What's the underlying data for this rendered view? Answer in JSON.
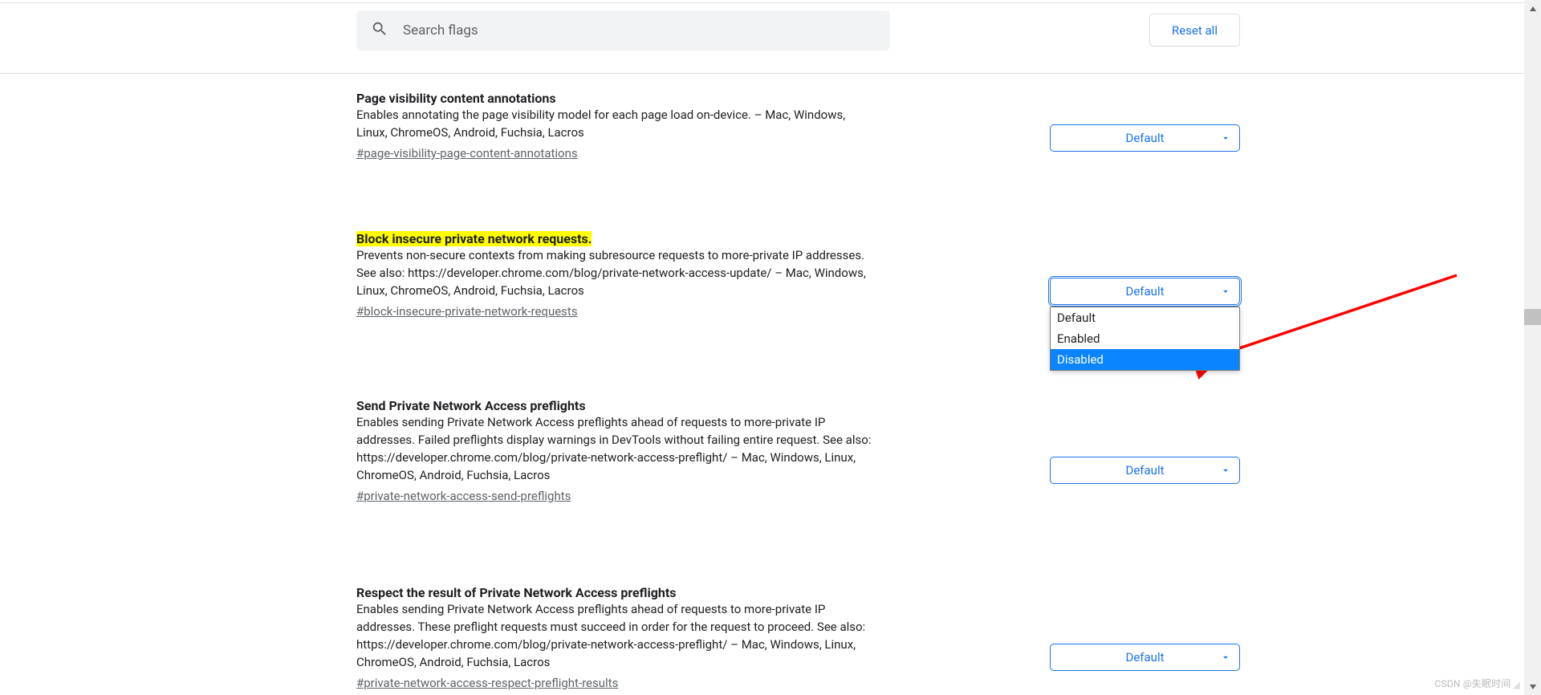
{
  "header": {
    "search_placeholder": "Search flags",
    "reset_label": "Reset all"
  },
  "dropdown_default": "Default",
  "dropdown_options": [
    "Default",
    "Enabled",
    "Disabled"
  ],
  "flags": [
    {
      "title": "Page visibility content annotations",
      "desc": "Enables annotating the page visibility model for each page load on-device. – Mac, Windows, Linux, ChromeOS, Android, Fuchsia, Lacros",
      "hash": "#page-visibility-page-content-annotations",
      "value": "Default",
      "highlighted": false
    },
    {
      "title": "Block insecure private network requests.",
      "desc": "Prevents non-secure contexts from making subresource requests to more-private IP addresses. See also: https://developer.chrome.com/blog/private-network-access-update/ – Mac, Windows, Linux, ChromeOS, Android, Fuchsia, Lacros",
      "hash": "#block-insecure-private-network-requests",
      "value": "Default",
      "highlighted": true,
      "dropdown_open": true,
      "selected_option": "Disabled"
    },
    {
      "title": "Send Private Network Access preflights",
      "desc": "Enables sending Private Network Access preflights ahead of requests to more-private IP addresses. Failed preflights display warnings in DevTools without failing entire request. See also: https://developer.chrome.com/blog/private-network-access-preflight/ – Mac, Windows, Linux, ChromeOS, Android, Fuchsia, Lacros",
      "hash": "#private-network-access-send-preflights",
      "value": "Default",
      "highlighted": false
    },
    {
      "title": "Respect the result of Private Network Access preflights",
      "desc": "Enables sending Private Network Access preflights ahead of requests to more-private IP addresses. These preflight requests must succeed in order for the request to proceed. See also: https://developer.chrome.com/blog/private-network-access-preflight/ – Mac, Windows, Linux, ChromeOS, Android, Fuchsia, Lacros",
      "hash": "#private-network-access-respect-preflight-results",
      "value": "Default",
      "highlighted": false
    }
  ],
  "watermark": "CSDN @失眠时间"
}
